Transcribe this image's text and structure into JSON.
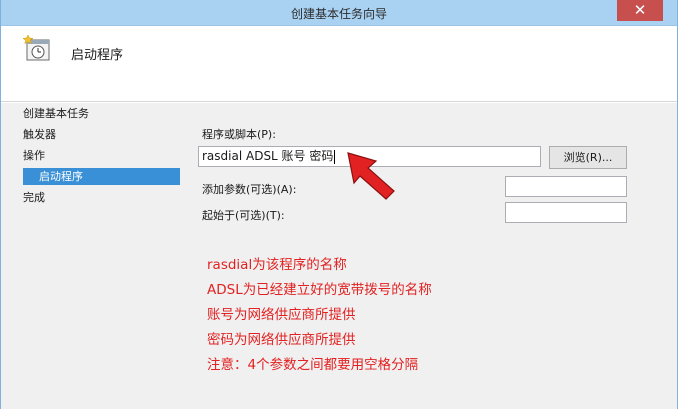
{
  "window": {
    "title": "创建基本任务向导",
    "close_glyph": "✕"
  },
  "header": {
    "title": "启动程序",
    "icon": "task-clock-icon"
  },
  "nav": {
    "items": [
      {
        "label": "创建基本任务",
        "selected": false
      },
      {
        "label": "触发器",
        "selected": false
      },
      {
        "label": "操作",
        "selected": false
      },
      {
        "label": "启动程序",
        "selected": true
      },
      {
        "label": "完成",
        "selected": false
      }
    ]
  },
  "form": {
    "program_label": "程序或脚本(P):",
    "program_value": "rasdial ADSL 账号 密码",
    "browse_label": "浏览(R)...",
    "args_label": "添加参数(可选)(A):",
    "args_value": "",
    "start_in_label": "起始于(可选)(T):",
    "start_in_value": ""
  },
  "annotation": {
    "arrow_color": "#e22222",
    "lines": [
      "rasdial为该程序的名称",
      "ADSL为已经建立好的宽带拨号的名称",
      "账号为网络供应商所提供",
      "密码为网络供应商所提供",
      "注意：4个参数之间都要用空格分隔"
    ]
  }
}
